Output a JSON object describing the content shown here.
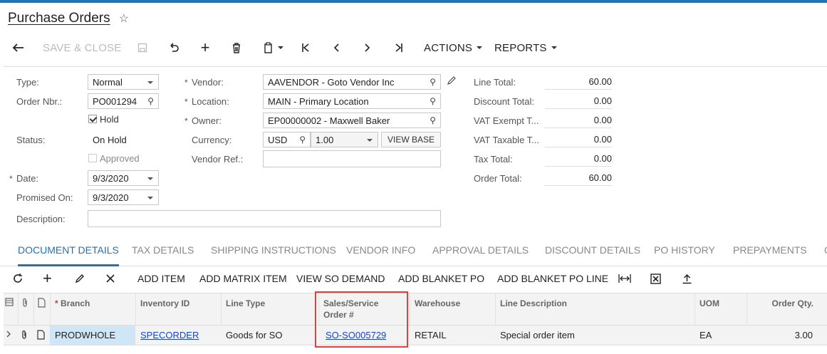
{
  "window": {
    "title": "Purchase Orders"
  },
  "toolbar": {
    "save_close": "SAVE & CLOSE",
    "actions": "ACTIONS",
    "reports": "REPORTS"
  },
  "form": {
    "type_label": "Type:",
    "type_value": "Normal",
    "order_nbr_label": "Order Nbr.:",
    "order_nbr_value": "PO001294",
    "hold_label": "Hold",
    "hold_checked": true,
    "status_label": "Status:",
    "status_value": "On Hold",
    "approved_label": "Approved",
    "approved_checked": false,
    "date_label": "Date:",
    "date_value": "9/3/2020",
    "promised_label": "Promised On:",
    "promised_value": "9/3/2020",
    "description_label": "Description:",
    "description_value": "",
    "vendor_label": "Vendor:",
    "vendor_value": "AAVENDOR - Goto Vendor Inc",
    "location_label": "Location:",
    "location_value": "MAIN - Primary Location",
    "owner_label": "Owner:",
    "owner_value": "EP00000002 - Maxwell Baker",
    "currency_label": "Currency:",
    "currency_value": "USD",
    "rate_value": "1.00",
    "view_base": "VIEW BASE",
    "vendor_ref_label": "Vendor Ref.:",
    "vendor_ref_value": ""
  },
  "totals": {
    "line_total_label": "Line Total:",
    "line_total": "60.00",
    "discount_total_label": "Discount Total:",
    "discount_total": "0.00",
    "vat_exempt_label": "VAT Exempt T...",
    "vat_exempt": "0.00",
    "vat_taxable_label": "VAT Taxable T...",
    "vat_taxable": "0.00",
    "tax_total_label": "Tax Total:",
    "tax_total": "0.00",
    "order_total_label": "Order Total:",
    "order_total": "60.00"
  },
  "tabs": [
    "DOCUMENT DETAILS",
    "TAX DETAILS",
    "SHIPPING INSTRUCTIONS",
    "VENDOR INFO",
    "APPROVAL DETAILS",
    "DISCOUNT DETAILS",
    "PO HISTORY",
    "PREPAYMENTS",
    "C"
  ],
  "grid_toolbar": {
    "add_item": "ADD ITEM",
    "add_matrix_item": "ADD MATRIX ITEM",
    "view_so_demand": "VIEW SO DEMAND",
    "add_blanket_po": "ADD BLANKET PO",
    "add_blanket_po_line": "ADD BLANKET PO LINE"
  },
  "grid": {
    "headers": {
      "branch": "Branch",
      "inventory_id": "Inventory ID",
      "line_type": "Line Type",
      "sales_order_line1": "Sales/Service",
      "sales_order_line2": "Order #",
      "warehouse": "Warehouse",
      "line_description": "Line Description",
      "uom": "UOM",
      "order_qty": "Order Qty."
    },
    "rows": [
      {
        "branch": "PRODWHOLE",
        "inventory_id": "SPECORDER",
        "line_type": "Goods for SO",
        "sales_order": "SO-SO005729",
        "warehouse": "RETAIL",
        "line_description": "Special order item",
        "uom": "EA",
        "order_qty": "3.00"
      }
    ]
  },
  "colors": {
    "accent": "#1f73b7",
    "highlight": "#e04040",
    "link": "#1a44c8"
  }
}
